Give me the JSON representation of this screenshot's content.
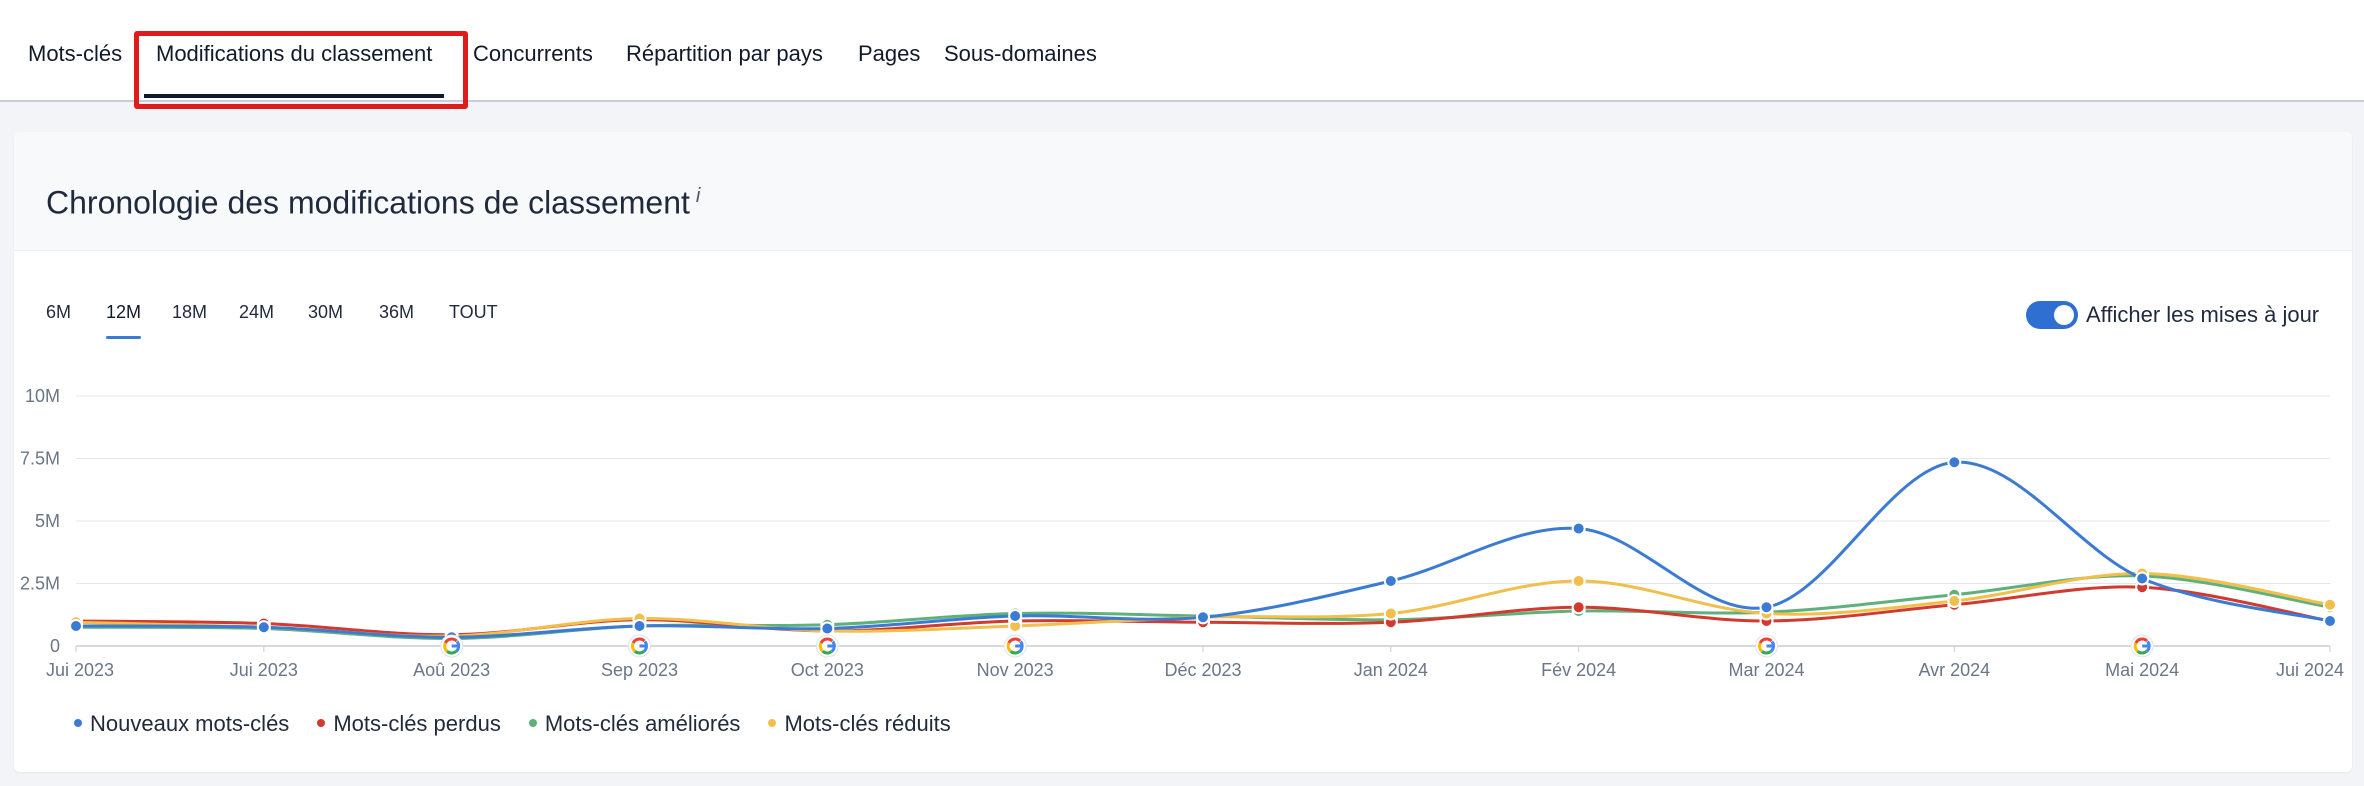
{
  "tabs": [
    {
      "label": "Mots-clés",
      "active": false
    },
    {
      "label": "Modifications du classement",
      "active": true
    },
    {
      "label": "Concurrents",
      "active": false
    },
    {
      "label": "Répartition par pays",
      "active": false
    },
    {
      "label": "Pages",
      "active": false
    },
    {
      "label": "Sous-domaines",
      "active": false
    }
  ],
  "card": {
    "title": "Chronologie des modifications de classement",
    "info_marker": "i"
  },
  "periods": [
    "6M",
    "12M",
    "18M",
    "24M",
    "30M",
    "36M",
    "TOUT"
  ],
  "active_period": "12M",
  "toggle": {
    "label": "Afficher les mises à jour",
    "on": true
  },
  "colors": {
    "blue": "#3b7bd4",
    "red": "#d13a2f",
    "green": "#5fb07a",
    "yellow": "#f0bf4c",
    "accent": "#2f6fd1",
    "highlight": "#e01b1b"
  },
  "chart_data": {
    "type": "line",
    "x": [
      "Jui 2023",
      "Jui 2023",
      "Aoû 2023",
      "Sep 2023",
      "Oct 2023",
      "Nov 2023",
      "Déc 2023",
      "Jan 2024",
      "Fév 2024",
      "Mar 2024",
      "Avr 2024",
      "Mai 2024",
      "Jui 2024"
    ],
    "y_ticks": [
      "10M",
      "7.5M",
      "5M",
      "2.5M",
      "0"
    ],
    "ylim": [
      0,
      10000000
    ],
    "grid": true,
    "legend_position": "bottom-left",
    "series": [
      {
        "name": "Nouveaux mots-clés",
        "color": "#3b7bd4",
        "values": [
          0.8,
          0.75,
          0.35,
          0.8,
          0.7,
          1.2,
          1.15,
          2.6,
          4.7,
          1.55,
          7.35,
          2.7,
          1.0
        ]
      },
      {
        "name": "Mots-clés perdus",
        "color": "#d13a2f",
        "values": [
          1.0,
          0.9,
          0.45,
          1.05,
          0.6,
          1.0,
          0.95,
          0.95,
          1.55,
          1.0,
          1.65,
          2.35,
          1.0
        ]
      },
      {
        "name": "Mots-clés améliorés",
        "color": "#5fb07a",
        "values": [
          0.75,
          0.7,
          0.3,
          0.8,
          0.85,
          1.3,
          1.2,
          1.05,
          1.4,
          1.35,
          2.05,
          2.8,
          1.55
        ]
      },
      {
        "name": "Mots-clés réduits",
        "color": "#f0bf4c",
        "values": [
          0.95,
          0.75,
          0.4,
          1.1,
          0.6,
          0.8,
          1.15,
          1.3,
          2.6,
          1.3,
          1.8,
          2.9,
          1.65
        ]
      }
    ],
    "value_unit": "millions",
    "update_markers_at": [
      "Aoû 2023",
      "Sep 2023",
      "Oct 2023",
      "Nov 2023",
      "Mar 2024",
      "Mai 2024"
    ]
  }
}
